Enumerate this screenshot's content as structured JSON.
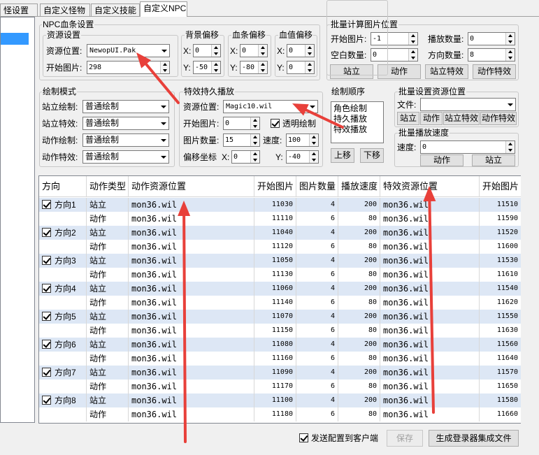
{
  "tabs": [
    "怪设置",
    "自定义怪物",
    "自定义技能",
    "自定义NPC"
  ],
  "npc_blood": {
    "title": "NPC血条设置",
    "resource": {
      "title": "资源设置",
      "pos_label": "资源位置:",
      "pos_value": "NewopUI.Pak",
      "start_label": "开始图片:",
      "start_value": "298"
    },
    "bg_offset": {
      "title": "背景偏移",
      "x": "0",
      "y": "-50"
    },
    "bar_offset": {
      "title": "血条偏移",
      "x": "0",
      "y": "-80"
    },
    "val_offset": {
      "title": "血值偏移",
      "x": "0",
      "y": "0"
    },
    "x_label": "X:",
    "y_label": "Y:"
  },
  "batch_calc": {
    "title": "批量计算图片位置",
    "start_label": "开始图片:",
    "start_value": "-1",
    "play_count_label": "播放数量:",
    "play_count_value": "0",
    "blank_label": "空白数量:",
    "blank_value": "0",
    "dir_count_label": "方向数量:",
    "dir_count_value": "8",
    "buttons": [
      "站立",
      "动作",
      "站立特效",
      "动作特效"
    ]
  },
  "draw_mode": {
    "title": "绘制模式",
    "rows": [
      {
        "label": "站立绘制:",
        "value": "普通绘制"
      },
      {
        "label": "站立特效:",
        "value": "普通绘制"
      },
      {
        "label": "动作绘制:",
        "value": "普通绘制"
      },
      {
        "label": "动作特效:",
        "value": "普通绘制"
      }
    ]
  },
  "effect": {
    "title": "特效持久播放",
    "pos_label": "资源位置:",
    "pos_value": "Magic10.wil",
    "start_label": "开始图片:",
    "start_value": "0",
    "transparent_label": "透明绘制",
    "count_label": "图片数量:",
    "count_value": "15",
    "speed_label": "速度:",
    "speed_value": "100",
    "offset_label": "偏移坐标",
    "x_label": "X:",
    "x_value": "0",
    "y_label": "Y:",
    "y_value": "-40"
  },
  "draw_order": {
    "title": "绘制顺序",
    "items": [
      "角色绘制",
      "持久播放",
      "特效播放"
    ],
    "up": "上移",
    "down": "下移"
  },
  "batch_res": {
    "title": "批量设置资源位置",
    "file_label": "文件:",
    "buttons": [
      "站立",
      "动作",
      "站立特效",
      "动作特效"
    ]
  },
  "batch_speed": {
    "title": "批量播放速度",
    "speed_label": "速度:",
    "speed_value": "0",
    "buttons": [
      "动作",
      "站立"
    ]
  },
  "table": {
    "headers": [
      "方向",
      "动作类型",
      "动作资源位置",
      "开始图片",
      "图片数量",
      "播放速度",
      "特效资源位置",
      "开始图片"
    ],
    "rows": [
      {
        "dir": "方向1",
        "type": "站立",
        "res": "mon36.wil",
        "start": "11030",
        "count": "4",
        "speed": "200",
        "eff": "mon36.wil",
        "estart": "11510"
      },
      {
        "dir": "",
        "type": "动作",
        "res": "mon36.wil",
        "start": "11110",
        "count": "6",
        "speed": "80",
        "eff": "mon36.wil",
        "estart": "11590"
      },
      {
        "dir": "方向2",
        "type": "站立",
        "res": "mon36.wil",
        "start": "11040",
        "count": "4",
        "speed": "200",
        "eff": "mon36.wil",
        "estart": "11520"
      },
      {
        "dir": "",
        "type": "动作",
        "res": "mon36.wil",
        "start": "11120",
        "count": "6",
        "speed": "80",
        "eff": "mon36.wil",
        "estart": "11600"
      },
      {
        "dir": "方向3",
        "type": "站立",
        "res": "mon36.wil",
        "start": "11050",
        "count": "4",
        "speed": "200",
        "eff": "mon36.wil",
        "estart": "11530"
      },
      {
        "dir": "",
        "type": "动作",
        "res": "mon36.wil",
        "start": "11130",
        "count": "6",
        "speed": "80",
        "eff": "mon36.wil",
        "estart": "11610"
      },
      {
        "dir": "方向4",
        "type": "站立",
        "res": "mon36.wil",
        "start": "11060",
        "count": "4",
        "speed": "200",
        "eff": "mon36.wil",
        "estart": "11540"
      },
      {
        "dir": "",
        "type": "动作",
        "res": "mon36.wil",
        "start": "11140",
        "count": "6",
        "speed": "80",
        "eff": "mon36.wil",
        "estart": "11620"
      },
      {
        "dir": "方向5",
        "type": "站立",
        "res": "mon36.wil",
        "start": "11070",
        "count": "4",
        "speed": "200",
        "eff": "mon36.wil",
        "estart": "11550"
      },
      {
        "dir": "",
        "type": "动作",
        "res": "mon36.wil",
        "start": "11150",
        "count": "6",
        "speed": "80",
        "eff": "mon36.wil",
        "estart": "11630"
      },
      {
        "dir": "方向6",
        "type": "站立",
        "res": "mon36.wil",
        "start": "11080",
        "count": "4",
        "speed": "200",
        "eff": "mon36.wil",
        "estart": "11560"
      },
      {
        "dir": "",
        "type": "动作",
        "res": "mon36.wil",
        "start": "11160",
        "count": "6",
        "speed": "80",
        "eff": "mon36.wil",
        "estart": "11640"
      },
      {
        "dir": "方向7",
        "type": "站立",
        "res": "mon36.wil",
        "start": "11090",
        "count": "4",
        "speed": "200",
        "eff": "mon36.wil",
        "estart": "11570"
      },
      {
        "dir": "",
        "type": "动作",
        "res": "mon36.wil",
        "start": "11170",
        "count": "6",
        "speed": "80",
        "eff": "mon36.wil",
        "estart": "11650"
      },
      {
        "dir": "方向8",
        "type": "站立",
        "res": "mon36.wil",
        "start": "11100",
        "count": "4",
        "speed": "200",
        "eff": "mon36.wil",
        "estart": "11580"
      },
      {
        "dir": "",
        "type": "动作",
        "res": "mon36.wil",
        "start": "11180",
        "count": "6",
        "speed": "80",
        "eff": "mon36.wil",
        "estart": "11660"
      }
    ]
  },
  "footer": {
    "send_label": "发送配置到客户端",
    "save_label": "保存",
    "gen_label": "生成登录器集成文件"
  },
  "annotation_color": "#e8403a"
}
